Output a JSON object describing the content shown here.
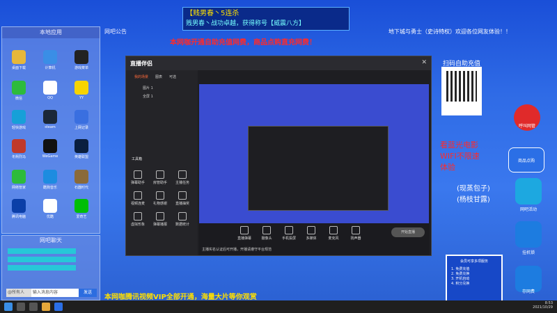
{
  "banner": {
    "line1": "【贱男春丶5连杀",
    "line2": "贱男春丶战功卓越，获得称号【威震八方】"
  },
  "left_panel": {
    "title": "本地应用",
    "apps": [
      {
        "label": "桌面下载"
      },
      {
        "label": "计算机"
      },
      {
        "label": "游戏菜单"
      },
      {
        "label": "微信"
      },
      {
        "label": "QQ"
      },
      {
        "label": "YY"
      },
      {
        "label": "轻快游戏"
      },
      {
        "label": "steam"
      },
      {
        "label": "上网记录"
      },
      {
        "label": "冬熙烈马"
      },
      {
        "label": "WeGame"
      },
      {
        "label": "英雄联盟"
      },
      {
        "label": "网络管家"
      },
      {
        "label": "酷狗音乐"
      },
      {
        "label": "石器时代"
      },
      {
        "label": "腾讯电脑"
      },
      {
        "label": "优酷"
      },
      {
        "label": "爱奇艺"
      }
    ]
  },
  "chat": {
    "title": "网吧聊天",
    "who": "@所有人",
    "placeholder": "输入消息内容",
    "send": "发送"
  },
  "notice": {
    "label": "网吧公告",
    "text1": "本网咖开通自助充值网费，商品点购直充网费！",
    "text2": "地下城与勇士（史诗特权）欢迎各位网友体验！！"
  },
  "app_window": {
    "title": "直播伴侣",
    "tab1": "我的场景",
    "tab2": "图表",
    "tab3": "可选",
    "scene1": "图片 1",
    "scene2": "全屏 1",
    "tools_label": "工具箱",
    "tools": [
      "弹幕助手",
      "房管助手",
      "主播任务",
      "视频连麦",
      "礼物感谢",
      "直播抽奖",
      "虚拟形象",
      "弹幕播报",
      "数据统计"
    ],
    "bottom_tools": [
      "直播弹幕",
      "摄像头",
      "手机投屏",
      "多媒体",
      "麦克风",
      "扬声器"
    ],
    "start_label": "开始直播",
    "notice": "主播实名认证后可开播，开播请遵守平台规范"
  },
  "right": {
    "qr_title": "扫码自助充值",
    "movie_line1": "看蓝光电影",
    "movie_line2": "WIFI不限速",
    "movie_line3": "体验",
    "side_note1": "(现蒸包子)",
    "side_note2": "(杨枝甘露)",
    "buttons": [
      "呼叫网管",
      "商品点购",
      "网吧活动",
      "挂机锁",
      "存网费"
    ],
    "info_title": "会员可享多项服务",
    "info_items": [
      "1. 免费充值",
      "2. 免费兑换",
      "3. 开机自动",
      "4. 积分兑换"
    ]
  },
  "scroller": "本网咖腾讯视频VIP全部开通，海量大片等你观赏",
  "taskbar": {
    "time": "8:53",
    "date": "2021/10/29"
  },
  "colors": {
    "desktop_blue": "#2f6be6",
    "notice_red": "#ff2a2a",
    "banner_yellow": "#ffe000"
  }
}
